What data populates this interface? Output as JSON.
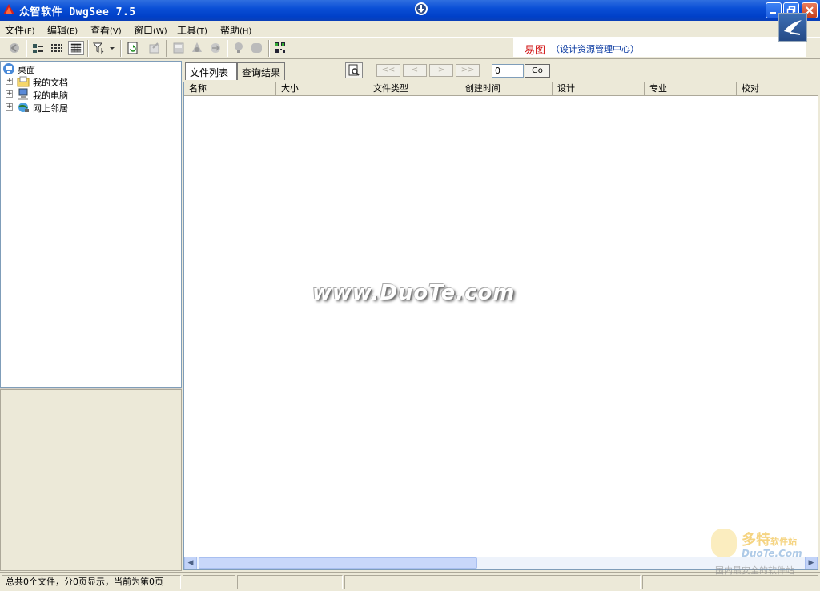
{
  "window": {
    "title": "众智软件 DwgSee 7.5",
    "colors": {
      "titlebar": "#0a4fd6",
      "close": "#c8401e"
    }
  },
  "menu": {
    "items": [
      {
        "label": "文件",
        "accel": "(F)"
      },
      {
        "label": "编辑",
        "accel": "(E)"
      },
      {
        "label": "查看",
        "accel": "(V)"
      },
      {
        "label": "窗口",
        "accel": "(W)"
      },
      {
        "label": "工具",
        "accel": "(T)"
      },
      {
        "label": "帮助",
        "accel": "(H)"
      }
    ]
  },
  "toolbar": {
    "icons": [
      "back-icon",
      "large-icons-view-icon",
      "list-view-icon",
      "details-view-icon",
      "filter-icon",
      "refresh-icon",
      "export-icon",
      "print-icon",
      "layers-icon",
      "convert-icon",
      "light-icon",
      "block-icon",
      "qrcode-icon"
    ],
    "brand_red": "易图",
    "brand_blue": "（设计资源管理中心）"
  },
  "tree": {
    "root": "桌面",
    "items": [
      {
        "label": "我的文档",
        "icon": "my-documents-icon"
      },
      {
        "label": "我的电脑",
        "icon": "my-computer-icon"
      },
      {
        "label": "网上邻居",
        "icon": "network-icon"
      }
    ]
  },
  "tabs": [
    {
      "label": "文件列表",
      "active": true
    },
    {
      "label": "查询结果",
      "active": false
    }
  ],
  "pager": {
    "buttons": [
      "<<",
      "<",
      ">",
      ">>"
    ],
    "page_value": "0",
    "go_label": "Go"
  },
  "columns": [
    "名称",
    "大小",
    "文件类型",
    "创建时间",
    "设计",
    "专业",
    "校对"
  ],
  "watermark": "www.DuoTe.com",
  "status": {
    "text": "总共0个文件，分0页显示，当前为第0页"
  },
  "site_watermark": {
    "line1": "多特",
    "line1_small": "软件站",
    "line2": "DuoTe.Com",
    "line3": "国内最安全的软件站"
  }
}
